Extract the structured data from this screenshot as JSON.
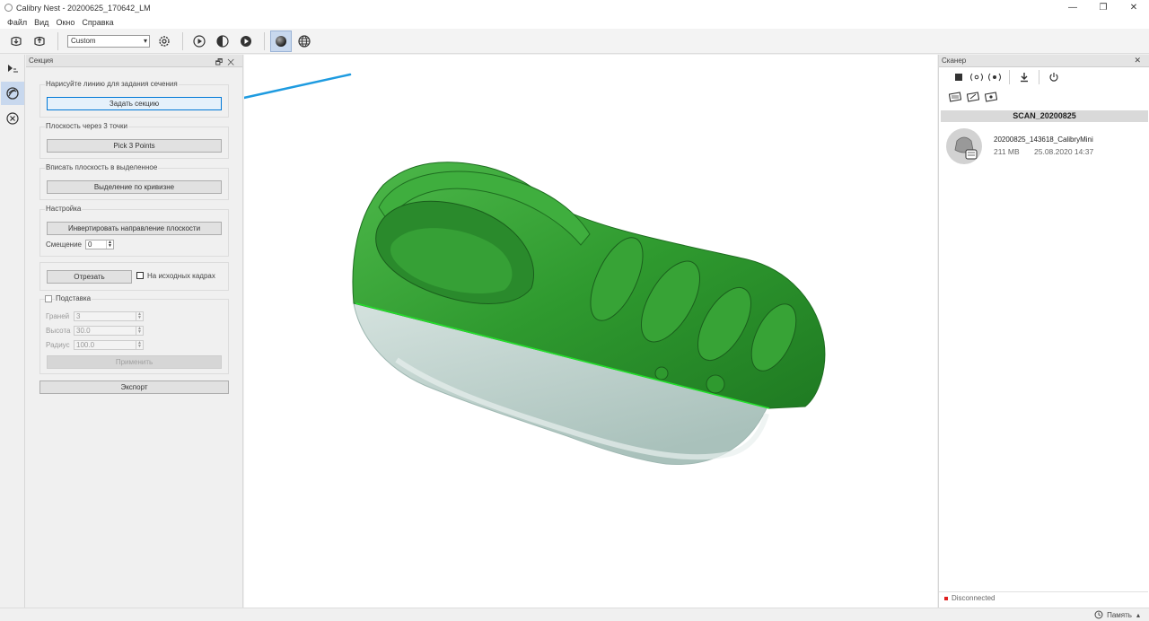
{
  "window": {
    "title": "Calibry Nest - 20200625_170642_LM",
    "minimize": "—",
    "restore": "❐",
    "close": "✕"
  },
  "menu": [
    "Файл",
    "Вид",
    "Окно",
    "Справка"
  ],
  "toolbar": {
    "preset_value": "Custom",
    "preset_arrow": "▾"
  },
  "section_panel": {
    "title": "Секция",
    "header_buttons": "🗗✕",
    "draw_line_group": {
      "title": "Нарисуйте линию для задания сечения",
      "button": "Задать секцию"
    },
    "three_points_group": {
      "title": "Плоскость через 3 точки",
      "button": "Pick 3 Points"
    },
    "fit_plane_group": {
      "title": "Вписать плоскость в выделенное",
      "button": "Выделение по кривизне"
    },
    "settings_group": {
      "title": "Настройка",
      "invert_button": "Инвертировать направление плоскости",
      "offset_label": "Смещение",
      "offset_value": "0"
    },
    "cut_group": {
      "cut_button": "Отрезать",
      "source_frames_label": "На исходных кадрах"
    },
    "stand_group": {
      "title": "Подставка",
      "faces_label": "Граней",
      "faces_value": "3",
      "height_label": "Высота",
      "height_value": "30.0",
      "radius_label": "Радиус",
      "radius_value": "100.0",
      "apply_button": "Применить"
    },
    "export_button": "Экспорт"
  },
  "scanner_panel": {
    "title": "Сканер",
    "header_close": "✕",
    "scan_title": "SCAN_20200825",
    "item": {
      "name": "20200825_143618_CalibryMini",
      "size": "211 MB",
      "date": "25.08.2020 14:37"
    },
    "status": "Disconnected"
  },
  "statusbar": {
    "memory_label": "Память",
    "memory_arrow": "▴"
  },
  "colors": {
    "model_green": "#2f9a2f",
    "model_gray": "#b9cfca",
    "cut_line": "#22e02a",
    "draw_line": "#1e9be0",
    "accent_blue": "#0078d7"
  }
}
